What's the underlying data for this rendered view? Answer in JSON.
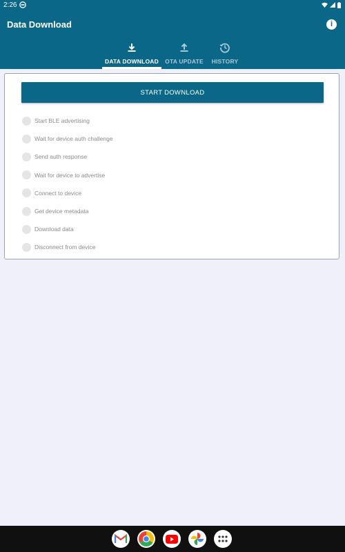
{
  "status_bar": {
    "time": "2:26"
  },
  "app_bar": {
    "title": "Data Download",
    "info_icon": "info-icon"
  },
  "tabs": [
    {
      "label": "DATA DOWNLOAD",
      "icon": "download-icon",
      "active": true
    },
    {
      "label": "OTA UPDATE",
      "icon": "upload-icon",
      "active": false
    },
    {
      "label": "HISTORY",
      "icon": "history-icon",
      "active": false
    }
  ],
  "download_card": {
    "start_button_label": "START DOWNLOAD",
    "steps": [
      {
        "label": "Start BLE advertising"
      },
      {
        "label": "Wait for device auth challenge"
      },
      {
        "label": "Send auth response"
      },
      {
        "label": "Wait for device to advertise"
      },
      {
        "label": "Connect to device"
      },
      {
        "label": "Get device metadata"
      },
      {
        "label": "Download data"
      },
      {
        "label": "Disconnect from device"
      }
    ]
  },
  "dock": {
    "apps": [
      "gmail-icon",
      "chrome-icon",
      "youtube-icon",
      "photos-icon",
      "app-drawer-icon"
    ]
  },
  "colors": {
    "primary": "#0b6788",
    "background": "#f0f0fa",
    "step_dot": "#e5e5e5"
  }
}
